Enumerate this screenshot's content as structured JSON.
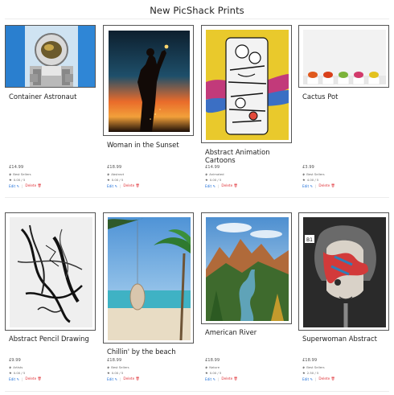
{
  "page": {
    "title": "New PicShack Prints"
  },
  "labels": {
    "edit": "Edit",
    "delete": "Delete",
    "separator": "|"
  },
  "icons": {
    "tag": "tag-icon",
    "star": "star-icon",
    "pencil": "pencil-icon",
    "trash": "trash-icon"
  },
  "colors": {
    "edit": "#1e6fd9",
    "delete": "#e0343a",
    "frame": "#555555"
  },
  "products": [
    {
      "title": "Container Astronaut",
      "price": "£14.99",
      "category": "Best Sellers",
      "rating": "0.00 / 5"
    },
    {
      "title": "Woman in the Sunset",
      "price": "£18.99",
      "category": "Abstract",
      "rating": "0.00 / 5"
    },
    {
      "title": "Abstract Animation Cartoons",
      "price": "£14.99",
      "category": "Animated",
      "rating": "0.00 / 5"
    },
    {
      "title": "Cactus Pot",
      "price": "£3.99",
      "category": "Best Sellers",
      "rating": "4.00 / 5"
    },
    {
      "title": "Abstract Pencil Drawing",
      "price": "£9.99",
      "category": "Artists",
      "rating": "0.00 / 5"
    },
    {
      "title": "Chillin' by the beach",
      "price": "£18.99",
      "category": "Best Sellers",
      "rating": "0.00 / 5"
    },
    {
      "title": "American River",
      "price": "£18.99",
      "category": "Nature",
      "rating": "0.00 / 5"
    },
    {
      "title": "Superwoman Abstract",
      "price": "£18.99",
      "category": "Best Sellers",
      "rating": "2.50 / 5"
    }
  ]
}
